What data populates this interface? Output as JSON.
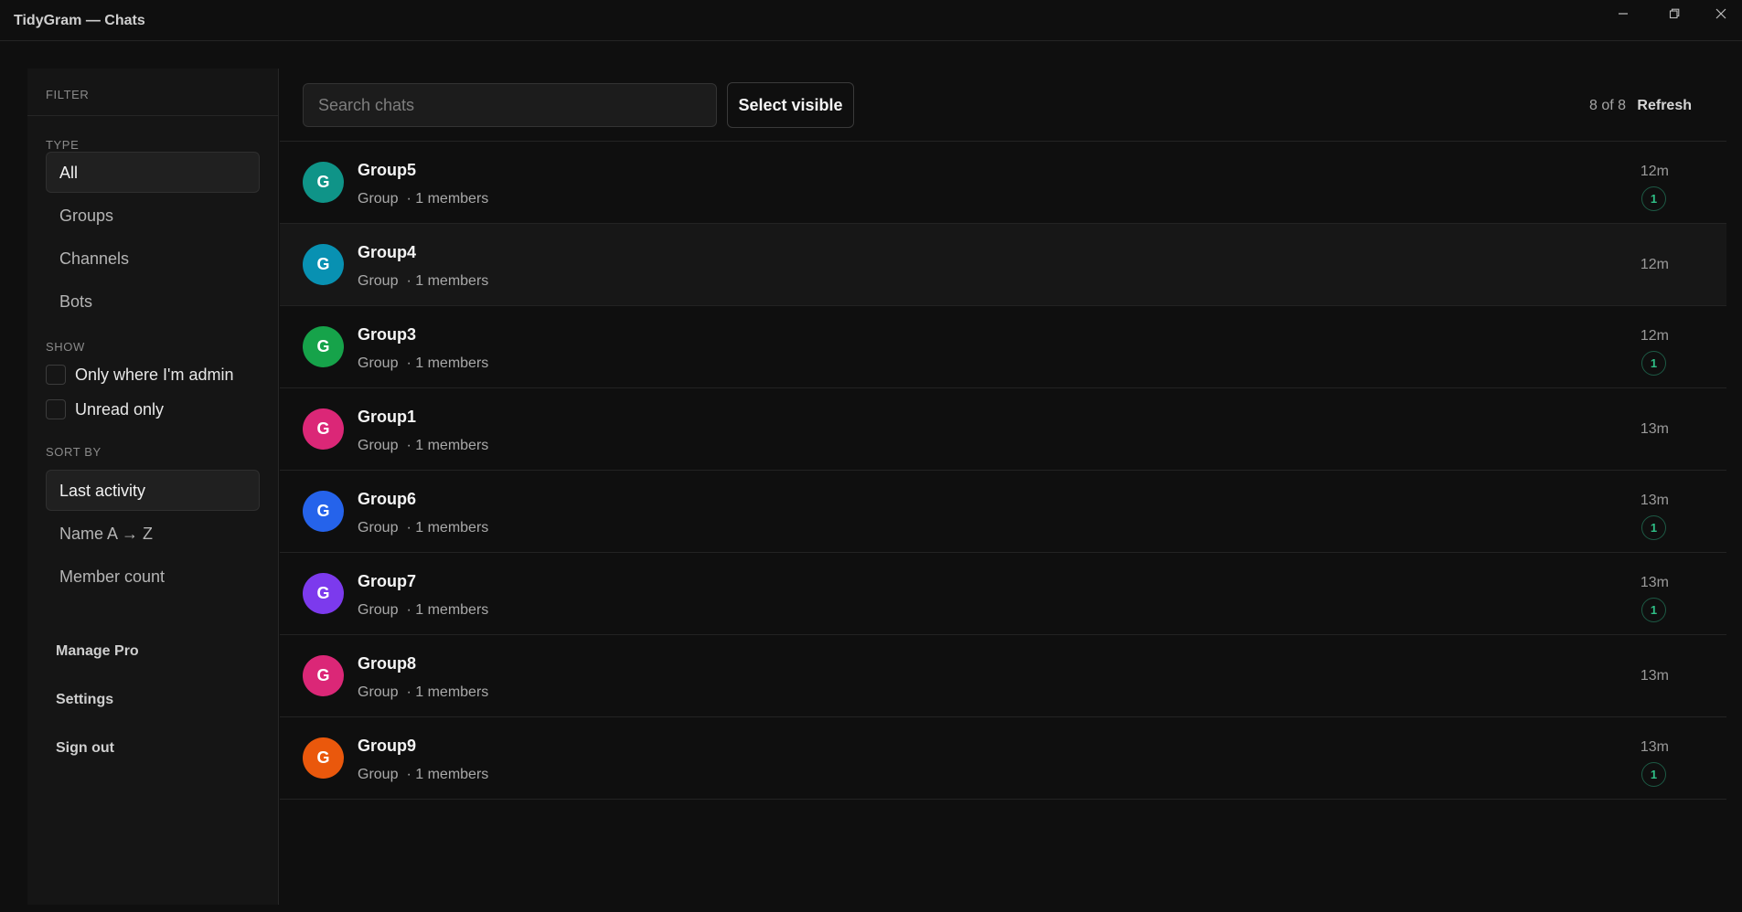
{
  "window": {
    "title": "TidyGram — Chats",
    "controls": [
      "minimize-icon",
      "restore-icon",
      "close-icon"
    ]
  },
  "sidebar": {
    "header": "FILTER",
    "type_label": "TYPE",
    "type_options": [
      {
        "label": "All",
        "active": true
      },
      {
        "label": "Groups",
        "active": false
      },
      {
        "label": "Channels",
        "active": false
      },
      {
        "label": "Bots",
        "active": false
      }
    ],
    "show_label": "SHOW",
    "show_options": [
      {
        "label": "Only where I'm admin",
        "checked": false
      },
      {
        "label": "Unread only",
        "checked": false
      }
    ],
    "sort_label": "SORT BY",
    "sort_options": [
      {
        "label": "Last activity",
        "active": true
      },
      {
        "label": "Name A → Z",
        "active": false
      },
      {
        "label": "Member count",
        "active": false
      }
    ],
    "links": [
      "Manage Pro",
      "Settings",
      "Sign out"
    ]
  },
  "toolbar": {
    "search_placeholder": "Search chats",
    "search_value": "",
    "select_label": "Select visible",
    "count": "8 of 8",
    "refresh_label": "Refresh"
  },
  "chats": [
    {
      "initial": "G",
      "name": "Group5",
      "type": "Group",
      "members": "· 1 members",
      "time": "12m",
      "unread": "1",
      "color": "#0f9488"
    },
    {
      "initial": "G",
      "name": "Group4",
      "type": "Group",
      "members": "· 1 members",
      "time": "12m",
      "unread": null,
      "color": "#0891b2"
    },
    {
      "initial": "G",
      "name": "Group3",
      "type": "Group",
      "members": "· 1 members",
      "time": "12m",
      "unread": "1",
      "color": "#16a34a"
    },
    {
      "initial": "G",
      "name": "Group1",
      "type": "Group",
      "members": "· 1 members",
      "time": "13m",
      "unread": null,
      "color": "#db2777"
    },
    {
      "initial": "G",
      "name": "Group6",
      "type": "Group",
      "members": "· 1 members",
      "time": "13m",
      "unread": "1",
      "color": "#2563eb"
    },
    {
      "initial": "G",
      "name": "Group7",
      "type": "Group",
      "members": "· 1 members",
      "time": "13m",
      "unread": "1",
      "color": "#7c3aed"
    },
    {
      "initial": "G",
      "name": "Group8",
      "type": "Group",
      "members": "· 1 members",
      "time": "13m",
      "unread": null,
      "color": "#db2777"
    },
    {
      "initial": "G",
      "name": "Group9",
      "type": "Group",
      "members": "· 1 members",
      "time": "13m",
      "unread": "1",
      "color": "#ea580c"
    }
  ]
}
